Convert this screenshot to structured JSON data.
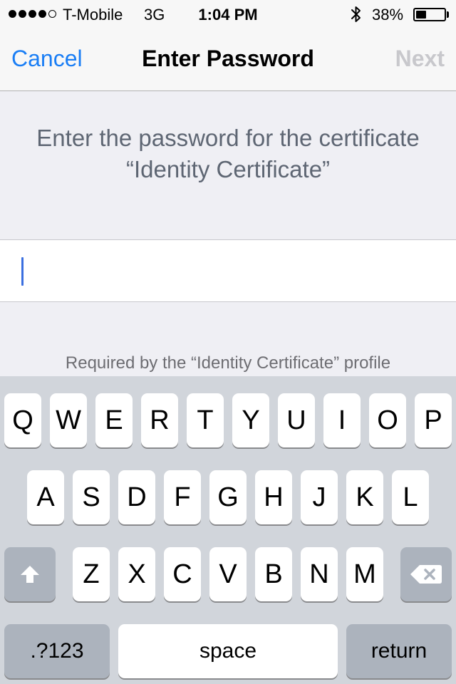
{
  "status_bar": {
    "carrier": "T-Mobile",
    "network": "3G",
    "time": "1:04 PM",
    "battery_percent": "38%",
    "battery_level": 0.38,
    "signal_bars": 4,
    "signal_total": 5,
    "bluetooth_icon": "bluetooth-icon"
  },
  "nav": {
    "cancel_label": "Cancel",
    "title": "Enter Password",
    "next_label": "Next"
  },
  "prompt": {
    "line1": "Enter the password for the certificate",
    "line2": "“Identity Certificate”"
  },
  "password_field": {
    "value": ""
  },
  "footnote": "Required by the “Identity Certificate” profile",
  "keyboard": {
    "row1": [
      "Q",
      "W",
      "E",
      "R",
      "T",
      "Y",
      "U",
      "I",
      "O",
      "P"
    ],
    "row2": [
      "A",
      "S",
      "D",
      "F",
      "G",
      "H",
      "J",
      "K",
      "L"
    ],
    "row3": [
      "Z",
      "X",
      "C",
      "V",
      "B",
      "N",
      "M"
    ],
    "numbers_label": ".?123",
    "space_label": "space",
    "return_label": "return",
    "shift_icon": "shift-arrow-icon",
    "delete_icon": "delete-backspace-icon"
  },
  "colors": {
    "accent": "#1a7ef5",
    "disabled": "#c8c8cc",
    "caret": "#3b6fe0",
    "keyboard_bg": "#d1d5db"
  }
}
